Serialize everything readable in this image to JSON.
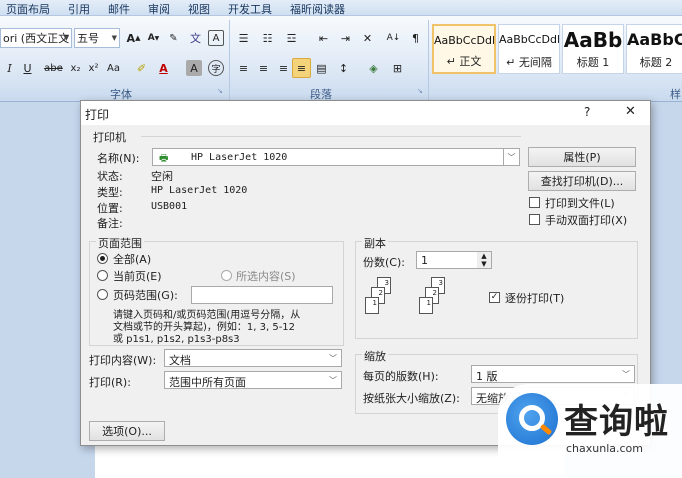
{
  "menu": [
    "页面布局",
    "引用",
    "邮件",
    "审阅",
    "视图",
    "开发工具",
    "福昕阅读器"
  ],
  "ribbon": {
    "font_name": "ori (西文正文",
    "font_size": "五号",
    "font_group_label": "字体",
    "paragraph_group_label": "段落",
    "styles_group_label": "样",
    "styles": [
      {
        "sample": "AaBbCcDdI",
        "name": "↵ 正文"
      },
      {
        "sample": "AaBbCcDdI",
        "name": "↵ 无间隔"
      },
      {
        "sample": "AaBb",
        "name": "标题 1"
      },
      {
        "sample": "AaBbC",
        "name": "标题 2"
      }
    ]
  },
  "dialog": {
    "title": "打印",
    "help": "?",
    "close": "✕",
    "printer": {
      "legend": "打印机",
      "name_label": "名称(N):",
      "name_value": "HP LaserJet 1020",
      "status_label": "状态:",
      "status_value": "空闲",
      "type_label": "类型:",
      "type_value": "HP LaserJet 1020",
      "where_label": "位置:",
      "where_value": "USB001",
      "comment_label": "备注:",
      "properties_button": "属性(P)",
      "find_button": "查找打印机(D)...",
      "print_to_file": "打印到文件(L)",
      "manual_duplex": "手动双面打印(X)"
    },
    "page_range": {
      "legend": "页面范围",
      "all": "全部(A)",
      "current": "当前页(E)",
      "selection": "所选内容(S)",
      "pages": "页码范围(G):",
      "hint": [
        "请键入页码和/或页码范围(用逗号分隔，从",
        "文档或节的开头算起)，例如：1, 3, 5-12",
        "或 p1s1, p1s2, p1s3-p8s3"
      ]
    },
    "copies": {
      "legend": "副本",
      "count_label": "份数(C):",
      "count_value": "1",
      "collate": "逐份打印(T)",
      "collate_checked": true
    },
    "print_what_label": "打印内容(W):",
    "print_what_value": "文档",
    "print_label": "打印(R):",
    "print_value": "范围中所有页面",
    "zoom": {
      "legend": "缩放",
      "pages_per_sheet_label": "每页的版数(H):",
      "pages_per_sheet_value": "1 版",
      "scale_label": "按纸张大小缩放(Z):",
      "scale_value": "无缩放"
    },
    "options_button": "选项(O)..."
  },
  "watermark": {
    "text": "查询啦",
    "url": "chaxunla.com"
  }
}
